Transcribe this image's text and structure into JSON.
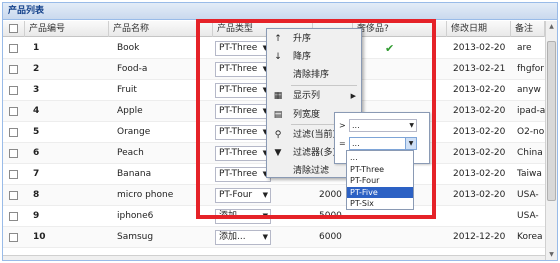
{
  "panel": {
    "title": "产品列表"
  },
  "columns": {
    "num": "产品编号",
    "name": "产品名称",
    "type": "产品类型",
    "luxury": "奢侈品?",
    "date": "修改日期",
    "remark": "备注"
  },
  "rows": [
    {
      "num": "1",
      "name": "Book",
      "type": "PT-Three",
      "price": "",
      "luxury_check": true,
      "date": "2013-02-20",
      "remark": "are"
    },
    {
      "num": "2",
      "name": "Food-a",
      "type": "PT-Three",
      "price": "",
      "luxury_check": false,
      "date": "2013-02-21",
      "remark": "fhgfor"
    },
    {
      "num": "3",
      "name": "Fruit",
      "type": "PT-Three",
      "price": "",
      "luxury_check": false,
      "date": "2013-02-20",
      "remark": "anyw"
    },
    {
      "num": "4",
      "name": "Apple",
      "type": "PT-Three",
      "price": "",
      "luxury_check": false,
      "date": "2013-02-20",
      "remark": "ipad-a"
    },
    {
      "num": "5",
      "name": "Orange",
      "type": "PT-Three",
      "price": "",
      "luxury_check": false,
      "date": "2013-02-20",
      "remark": "O2-no"
    },
    {
      "num": "6",
      "name": "Peach",
      "type": "PT-Three",
      "price": "",
      "luxury_check": false,
      "date": "2013-02-20",
      "remark": "China"
    },
    {
      "num": "7",
      "name": "Banana",
      "type": "PT-Three",
      "price": "",
      "luxury_check": false,
      "date": "2013-02-20",
      "remark": "Taiwa"
    },
    {
      "num": "8",
      "name": "micro phone",
      "type": "PT-Four",
      "price": "2000",
      "luxury_check": false,
      "date": "2013-02-20",
      "remark": "USA-"
    },
    {
      "num": "9",
      "name": "iphone6",
      "type": "添加...",
      "price": "5000",
      "luxury_check": false,
      "date": "",
      "remark": "USA-"
    },
    {
      "num": "10",
      "name": "Samsug",
      "type": "添加...",
      "price": "6000",
      "luxury_check": false,
      "date": "2012-12-20",
      "remark": "Korea"
    }
  ],
  "menu": {
    "items": [
      {
        "label": "升序",
        "icon": "sort-asc-icon",
        "glyph": "↑"
      },
      {
        "label": "降序",
        "icon": "sort-desc-icon",
        "glyph": "↓"
      },
      {
        "label": "清除排序",
        "icon": "",
        "glyph": ""
      },
      {
        "label": "显示列",
        "icon": "columns-icon",
        "glyph": "▦"
      },
      {
        "label": "列宽度",
        "icon": "column-width-icon",
        "glyph": "▤"
      },
      {
        "label": "过滤(当前)",
        "icon": "filter-icon",
        "glyph": "⚲"
      },
      {
        "label": "过滤器(多)",
        "icon": "funnel-icon",
        "glyph": "▼"
      },
      {
        "label": "清除过滤",
        "icon": "",
        "glyph": ""
      }
    ]
  },
  "filter": {
    "gt_symbol": ">",
    "eq_symbol": "=",
    "gt_value": "...",
    "eq_value": "..."
  },
  "dropdown": {
    "options": [
      "...",
      "PT-Three",
      "PT-Four",
      "PT-Five",
      "PT-Six"
    ],
    "selected_index": 3
  },
  "colors": {
    "highlight": "#e52228",
    "selection": "#2c61c4",
    "check": "#2e9a2e"
  }
}
